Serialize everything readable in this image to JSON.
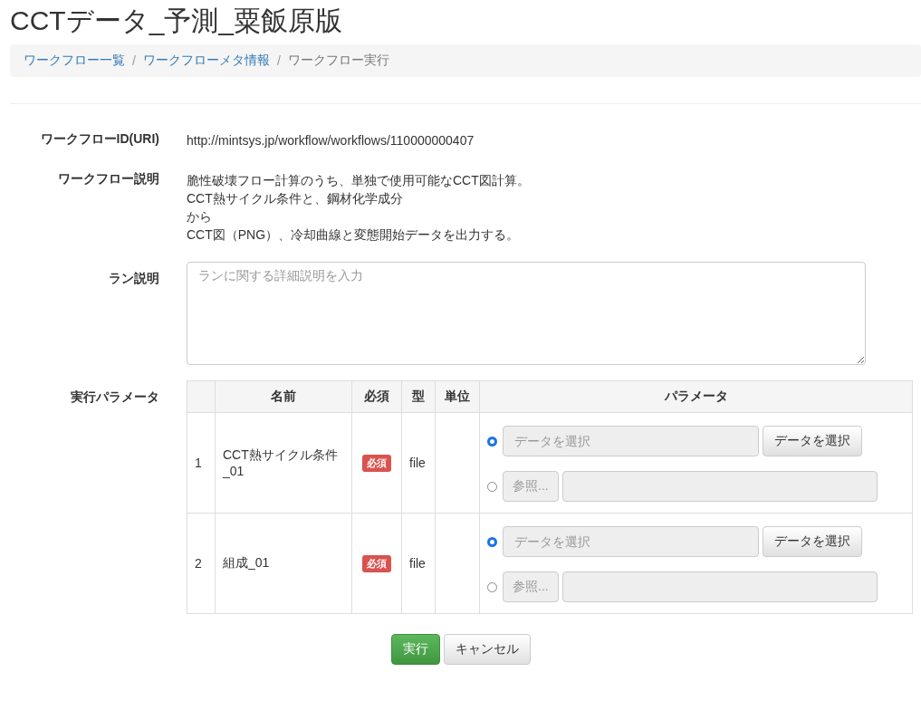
{
  "page_title": "CCTデータ_予測_粟飯原版",
  "breadcrumb": {
    "separator": "/",
    "items": [
      {
        "label": "ワークフロー一覧",
        "active": false
      },
      {
        "label": "ワークフローメタ情報",
        "active": false
      },
      {
        "label": "ワークフロー実行",
        "active": true
      }
    ]
  },
  "form": {
    "workflow_id": {
      "label": "ワークフローID(URI)",
      "value": "http://mintsys.jp/workflow/workflows/110000000407"
    },
    "workflow_description": {
      "label": "ワークフロー説明",
      "lines": [
        "脆性破壊フロー計算のうち、単独で使用可能なCCT図計算。",
        "CCT熱サイクル条件と、鋼材化学成分",
        "から",
        "CCT図（PNG）、冷却曲線と変態開始データを出力する。"
      ]
    },
    "run_description": {
      "label": "ラン説明",
      "placeholder": "ランに関する詳細説明を入力"
    },
    "parameters": {
      "label": "実行パラメータ",
      "columns": [
        "",
        "名前",
        "必須",
        "型",
        "単位",
        "パラメータ"
      ],
      "rows": [
        {
          "index": "1",
          "name": "CCT熱サイクル条件_01",
          "required": true,
          "required_label": "必須",
          "type": "file",
          "unit": "",
          "options": [
            {
              "kind": "data",
              "selected": true,
              "placeholder": "データを選択",
              "button": "データを選択"
            },
            {
              "kind": "file",
              "selected": false,
              "button": "参照..."
            }
          ]
        },
        {
          "index": "2",
          "name": "組成_01",
          "required": true,
          "required_label": "必須",
          "type": "file",
          "unit": "",
          "options": [
            {
              "kind": "data",
              "selected": true,
              "placeholder": "データを選択",
              "button": "データを選択"
            },
            {
              "kind": "file",
              "selected": false,
              "button": "参照..."
            }
          ]
        }
      ]
    }
  },
  "buttons": [
    {
      "label": "実行",
      "kind": "primary"
    },
    {
      "label": "キャンセル",
      "kind": "default"
    }
  ]
}
